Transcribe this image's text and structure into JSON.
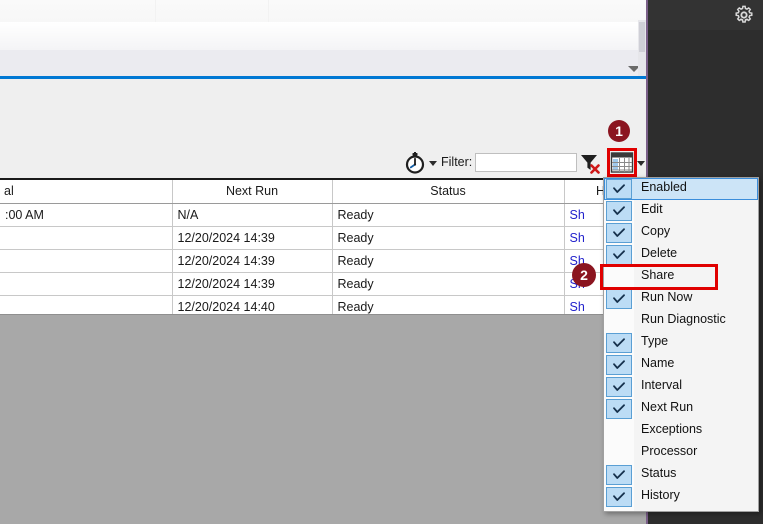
{
  "window": {
    "right_panel_gear_icon": "gear-icon",
    "ribbon_dropdown_icon": "chevron-down-icon"
  },
  "toolbar": {
    "clock_icon": "clock-icon",
    "clock_dropdown_icon": "chevron-down-icon",
    "filter_label": "Filter:",
    "filter_value": "",
    "filter_placeholder": "",
    "clear_filter_icon": "funnel-clear-icon",
    "grid_config_icon": "grid-columns-icon",
    "grid_config_dropdown_icon": "chevron-down-icon"
  },
  "table": {
    "columns": [
      "al",
      "Next Run",
      "Status",
      "His"
    ],
    "rows": [
      {
        "interval": ":00 AM",
        "next_run": "N/A",
        "status": "Ready",
        "history": "Sh"
      },
      {
        "interval": "",
        "next_run": "12/20/2024 14:39",
        "status": "Ready",
        "history": "Sh"
      },
      {
        "interval": "",
        "next_run": "12/20/2024 14:39",
        "status": "Ready",
        "history": "Sh"
      },
      {
        "interval": "",
        "next_run": "12/20/2024 14:39",
        "status": "Ready",
        "history": "Sh"
      },
      {
        "interval": "",
        "next_run": "12/20/2024 14:40",
        "status": "Ready",
        "history": "Sh"
      }
    ]
  },
  "context_menu": {
    "items": [
      {
        "label": "Enabled",
        "checked": true,
        "selected": true
      },
      {
        "label": "Edit",
        "checked": true,
        "selected": false
      },
      {
        "label": "Copy",
        "checked": true,
        "selected": false
      },
      {
        "label": "Delete",
        "checked": true,
        "selected": false
      },
      {
        "label": "Share",
        "checked": false,
        "selected": false
      },
      {
        "label": "Run Now",
        "checked": true,
        "selected": false
      },
      {
        "label": "Run Diagnostic",
        "checked": false,
        "selected": false
      },
      {
        "label": "Type",
        "checked": true,
        "selected": false
      },
      {
        "label": "Name",
        "checked": true,
        "selected": false
      },
      {
        "label": "Interval",
        "checked": true,
        "selected": false
      },
      {
        "label": "Next Run",
        "checked": true,
        "selected": false
      },
      {
        "label": "Exceptions",
        "checked": false,
        "selected": false
      },
      {
        "label": "Processor",
        "checked": false,
        "selected": false
      },
      {
        "label": "Status",
        "checked": true,
        "selected": false
      },
      {
        "label": "History",
        "checked": true,
        "selected": false
      }
    ]
  },
  "annotations": {
    "badge_1": "1",
    "badge_2": "2",
    "highlight_color": "#e00000",
    "badge_color": "#8b1520"
  }
}
